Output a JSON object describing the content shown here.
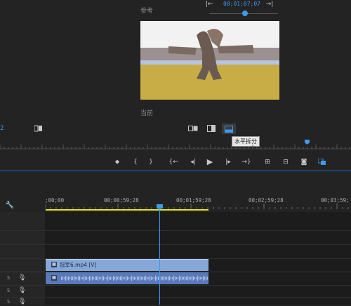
{
  "reference": {
    "label": "参考",
    "timecode": "00;01;07;07",
    "slider_position": 0.55
  },
  "current": {
    "label": "当前"
  },
  "view_controls": {
    "left_number": "2",
    "tooltip": "水平拆分"
  },
  "timeline": {
    "ruler_labels": [
      ";00;00",
      "00;00;59;28",
      "00;01;59;28",
      "00;02;59;28",
      "00;03;59;"
    ],
    "clip_label": "冠军6.mp4 [V]",
    "audio_tracks": [
      "S",
      "S",
      "S"
    ]
  },
  "colors": {
    "bg": "#232323",
    "accent": "#3d9aef",
    "video_clip": "#86a8d9",
    "audio_clip": "#5a79b8",
    "work_area": "#e6e21e"
  },
  "icons": [
    "mark-in-icon",
    "in-bracket-icon",
    "out-bracket-icon",
    "go-to-in-icon",
    "step-back-icon",
    "play-icon",
    "step-forward-icon",
    "go-to-out-icon",
    "lift-icon",
    "extract-icon",
    "camera-icon",
    "comparison-view-icon",
    "wrench-icon",
    "mic-icon"
  ]
}
